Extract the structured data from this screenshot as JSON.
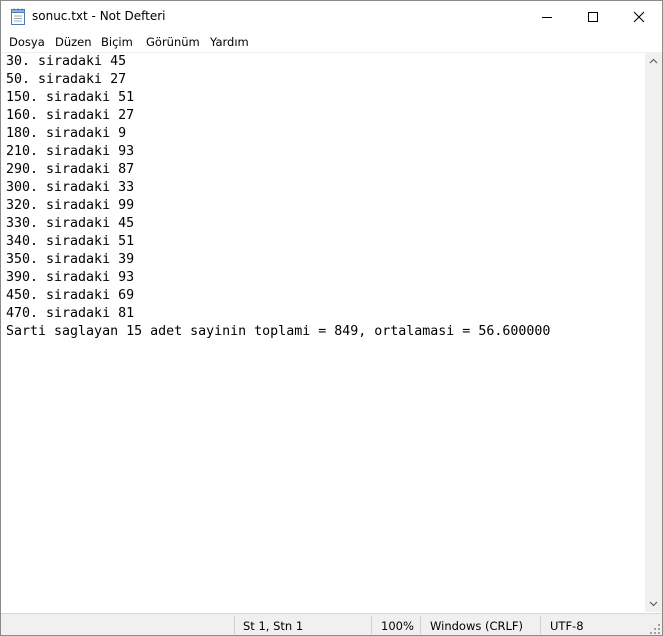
{
  "window": {
    "title": "sonuc.txt - Not Defteri"
  },
  "caption_buttons": {
    "minimize_icon": "minimize-icon",
    "maximize_icon": "maximize-icon",
    "close_icon": "close-icon"
  },
  "menu": {
    "items": [
      {
        "label": "Dosya"
      },
      {
        "label": "Düzen"
      },
      {
        "label": "Biçim"
      },
      {
        "label": "Görünüm"
      },
      {
        "label": "Yardım"
      }
    ]
  },
  "editor": {
    "lines": [
      "30. siradaki 45",
      "50. siradaki 27",
      "150. siradaki 51",
      "160. siradaki 27",
      "180. siradaki 9",
      "210. siradaki 93",
      "290. siradaki 87",
      "300. siradaki 33",
      "320. siradaki 99",
      "330. siradaki 45",
      "340. siradaki 51",
      "350. siradaki 39",
      "390. siradaki 93",
      "450. siradaki 69",
      "470. siradaki 81",
      "Sarti saglayan 15 adet sayinin toplami = 849, ortalamasi = 56.600000"
    ]
  },
  "status": {
    "position": "St 1, Stn 1",
    "zoom": "100%",
    "line_ending": "Windows (CRLF)",
    "encoding": "UTF-8"
  },
  "colors": {
    "chrome_bg": "#f0f0f0",
    "text": "#000000",
    "editor_bg": "#ffffff"
  }
}
